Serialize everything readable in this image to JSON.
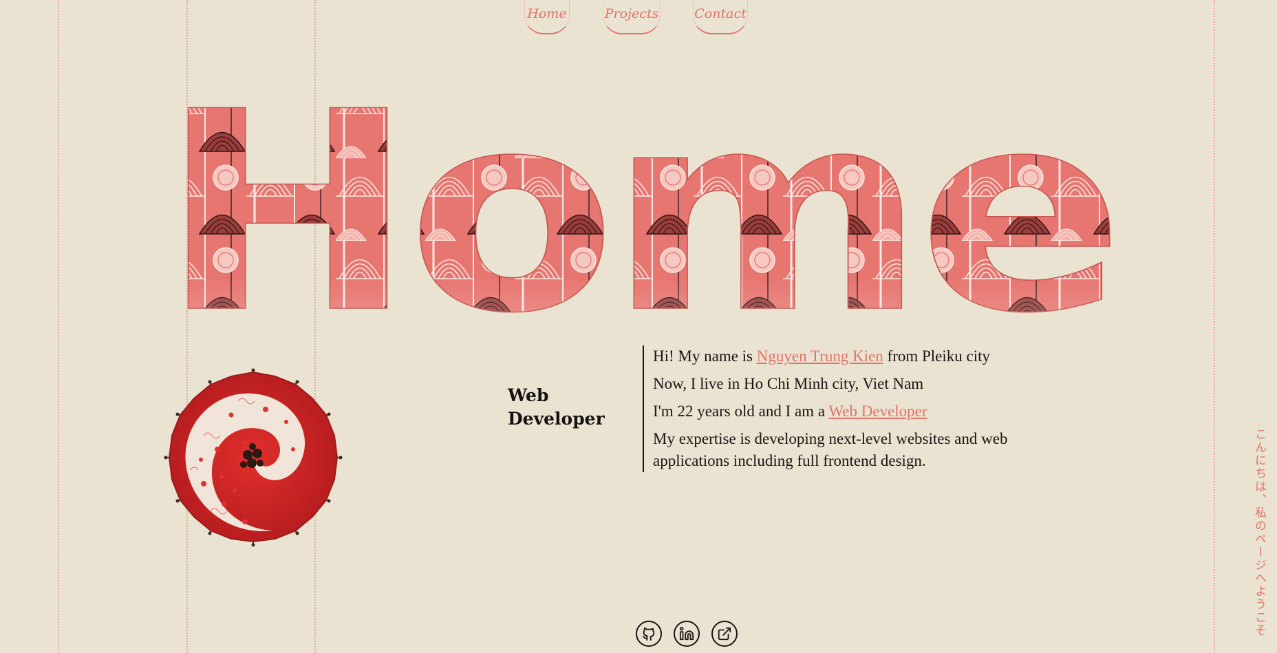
{
  "nav": {
    "items": [
      {
        "label": "Home"
      },
      {
        "label": "Projects"
      },
      {
        "label": "Contact"
      }
    ]
  },
  "hero": {
    "title": "Home"
  },
  "role": {
    "line1": "Web",
    "line2": "Developer"
  },
  "intro": {
    "line1_prefix": "Hi! My name is ",
    "name_link": "Nguyen Trung Kien",
    "line1_suffix": " from Pleiku city",
    "line2": "Now, I live in Ho Chi Minh city, Viet Nam",
    "line3_prefix": "I'm 22 years old and I am a ",
    "role_link": "Web Developer",
    "line4": "My expertise is developing next-level websites and web applications including full frontend design."
  },
  "side_text": "こんにちは、私のページへようこそ",
  "social": {
    "icons": [
      "github-icon",
      "linkedin-icon",
      "external-link-icon"
    ]
  },
  "colors": {
    "background": "#ebe3d1",
    "accent": "#e0736a",
    "text": "#1a1515"
  }
}
